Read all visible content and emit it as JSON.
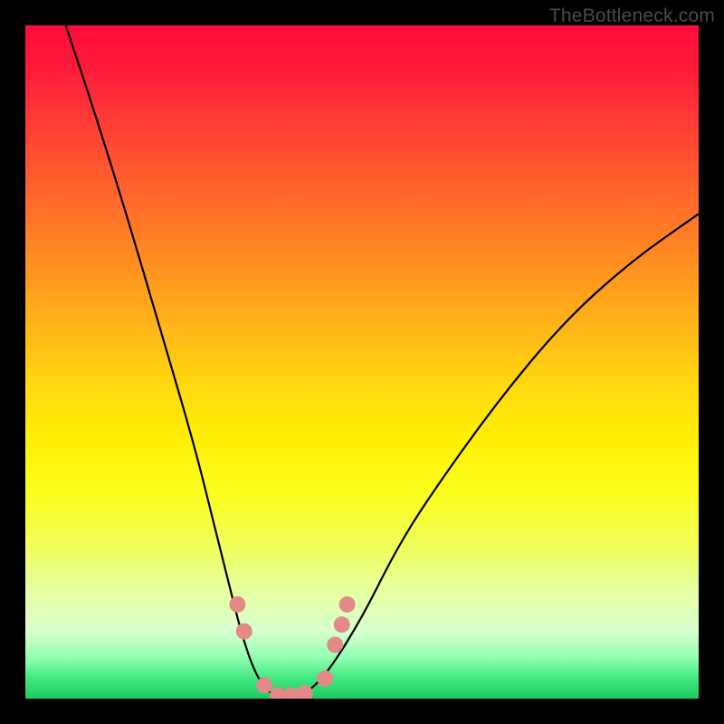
{
  "watermark": "TheBottleneck.com",
  "chart_data": {
    "type": "line",
    "title": "",
    "xlabel": "",
    "ylabel": "",
    "xlim": [
      0,
      100
    ],
    "ylim": [
      0,
      100
    ],
    "grid": false,
    "series": [
      {
        "name": "bottleneck-curve",
        "color": "#000000",
        "x": [
          6,
          10,
          15,
          20,
          25,
          28,
          30,
          32,
          34,
          36,
          38,
          40,
          42,
          45,
          50,
          55,
          60,
          70,
          80,
          90,
          100
        ],
        "y": [
          100,
          88,
          72,
          55,
          38,
          26,
          18,
          10,
          4,
          1,
          0,
          0,
          1,
          4,
          12,
          22,
          30,
          44,
          56,
          65,
          72
        ]
      }
    ],
    "markers": {
      "name": "highlighted-points",
      "color": "#e38a88",
      "points": [
        {
          "x": 31.5,
          "y": 14
        },
        {
          "x": 32.5,
          "y": 10
        },
        {
          "x": 35.5,
          "y": 2
        },
        {
          "x": 37.5,
          "y": 0.5
        },
        {
          "x": 39.5,
          "y": 0.5
        },
        {
          "x": 41.5,
          "y": 0.8
        },
        {
          "x": 44.5,
          "y": 3
        },
        {
          "x": 46.0,
          "y": 8
        },
        {
          "x": 47.0,
          "y": 11
        },
        {
          "x": 47.8,
          "y": 14
        }
      ]
    },
    "background_gradient": {
      "stops": [
        {
          "pos": 0.0,
          "color": "#ff0a3c"
        },
        {
          "pos": 0.3,
          "color": "#ff7a26"
        },
        {
          "pos": 0.6,
          "color": "#fff106"
        },
        {
          "pos": 0.85,
          "color": "#e6ffa0"
        },
        {
          "pos": 1.0,
          "color": "#20c860"
        }
      ]
    }
  }
}
